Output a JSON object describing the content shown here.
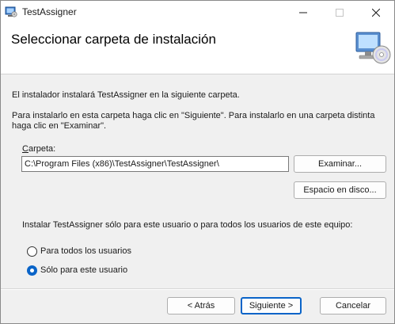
{
  "window": {
    "title": "TestAssigner",
    "app_icon": "installer-app-icon",
    "controls": {
      "minimize_icon": "minimize-icon",
      "maximize_icon": "maximize-icon",
      "close_icon": "close-icon"
    }
  },
  "banner": {
    "heading": "Seleccionar carpeta de instalación",
    "icon": "computer-disc-icon"
  },
  "body": {
    "intro": "El instalador instalará TestAssigner en la siguiente carpeta.",
    "help": "Para instalarlo en esta carpeta haga clic en \"Siguiente\". Para instalarlo en una carpeta distinta haga clic en \"Examinar\".",
    "folder_label_accel": "C",
    "folder_label_rest": "arpeta:",
    "folder_value": "C:\\Program Files (x86)\\TestAssigner\\TestAssigner\\",
    "browse_label": "Examinar...",
    "disk_space_label": "Espacio en disco...",
    "scope_question": "Instalar TestAssigner sólo para este usuario o para todos los usuarios de este equipo:",
    "options": [
      {
        "label": "Para todos los usuarios",
        "selected": false
      },
      {
        "label": "Sólo para este usuario",
        "selected": true
      }
    ]
  },
  "footer": {
    "back_label": "< Atrás",
    "next_label": "Siguiente >",
    "cancel_label": "Cancelar"
  },
  "colors": {
    "accent": "#0a64c8",
    "banner_bg": "#ffffff",
    "window_bg": "#f0f0f0"
  }
}
